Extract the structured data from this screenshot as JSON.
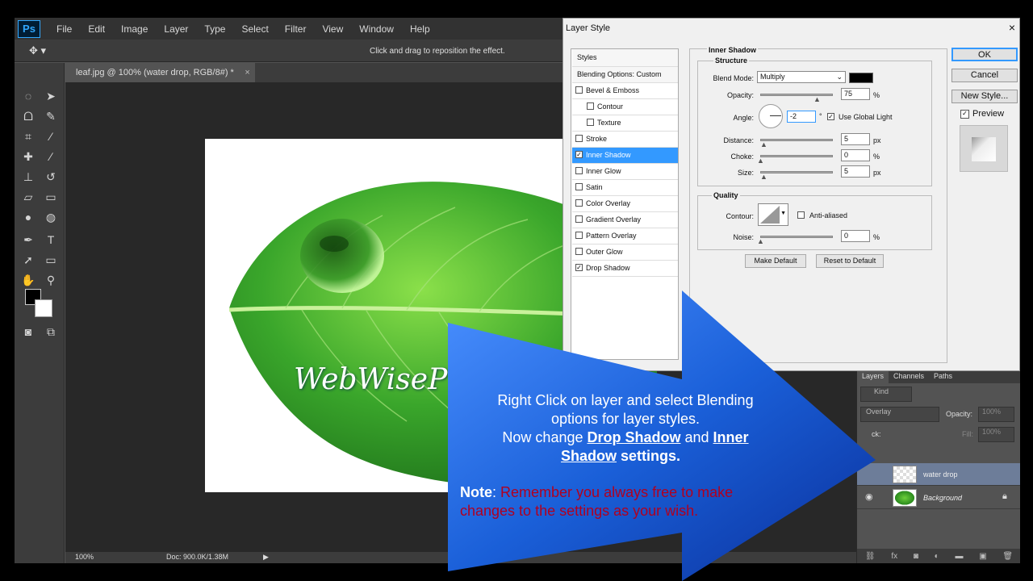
{
  "app": {
    "logo": "Ps"
  },
  "menu": [
    "File",
    "Edit",
    "Image",
    "Layer",
    "Type",
    "Select",
    "Filter",
    "View",
    "Window",
    "Help"
  ],
  "options_bar": {
    "hint": "Click and drag to reposition the effect."
  },
  "document": {
    "tab_title": "leaf.jpg @ 100% (water drop, RGB/8#) *",
    "watermark": "WebWisePro"
  },
  "status": {
    "zoom": "100%",
    "doc": "Doc: 900.0K/1.38M"
  },
  "layers_panel": {
    "tabs": [
      "Layers",
      "Channels",
      "Paths"
    ],
    "kind": "Kind",
    "blend_mode": "Overlay",
    "opacity_label": "Opacity:",
    "opacity_value": "100%",
    "fill_label": "Fill:",
    "fill_value": "100%",
    "lock_label": "ck:",
    "layers": [
      {
        "name": "water drop"
      },
      {
        "name": "Background"
      }
    ]
  },
  "dialog": {
    "title": "Layer Style",
    "styles_header": "Styles",
    "blending_options": "Blending Options: Custom",
    "style_items": [
      {
        "label": "Bevel & Emboss",
        "checked": false
      },
      {
        "label": "Contour",
        "checked": false
      },
      {
        "label": "Texture",
        "checked": false
      },
      {
        "label": "Stroke",
        "checked": false
      },
      {
        "label": "Inner Shadow",
        "checked": true
      },
      {
        "label": "Inner Glow",
        "checked": false
      },
      {
        "label": "Satin",
        "checked": false
      },
      {
        "label": "Color Overlay",
        "checked": false
      },
      {
        "label": "Gradient Overlay",
        "checked": false
      },
      {
        "label": "Pattern Overlay",
        "checked": false
      },
      {
        "label": "Outer Glow",
        "checked": false
      },
      {
        "label": "Drop Shadow",
        "checked": true
      }
    ],
    "section_title": "Inner Shadow",
    "structure_title": "Structure",
    "blend_mode_label": "Blend Mode:",
    "blend_mode_value": "Multiply",
    "opacity_label": "Opacity:",
    "opacity_value": "75",
    "percent": "%",
    "angle_label": "Angle:",
    "angle_value": "-2",
    "degree": "°",
    "global_light_label": "Use Global Light",
    "distance_label": "Distance:",
    "distance_value": "5",
    "choke_label": "Choke:",
    "choke_value": "0",
    "size_label": "Size:",
    "size_value": "5",
    "px": "px",
    "quality_title": "Quality",
    "contour_label": "Contour:",
    "anti_aliased_label": "Anti-aliased",
    "noise_label": "Noise:",
    "noise_value": "0",
    "make_default": "Make Default",
    "reset_default": "Reset to Default",
    "ok": "OK",
    "cancel": "Cancel",
    "new_style": "New Style...",
    "preview_label": "Preview",
    "shadow_color": "#000000"
  },
  "note": {
    "line1": "Right Click on layer and select Blending",
    "line2": "options for layer styles.",
    "line3_pre": "Now change ",
    "drop_shadow": "Drop Shadow",
    "and": " and ",
    "inner_shadow_a": "Inner ",
    "inner_shadow_b": "Shadow",
    "settings": " settings.",
    "label": "Note",
    "colon": ": ",
    "body": "Remember you always free to make changes to the settings as your wish."
  },
  "colors": {
    "arrow": "#1560d8",
    "note_red": "#b00020",
    "selection": "#3399ff"
  }
}
